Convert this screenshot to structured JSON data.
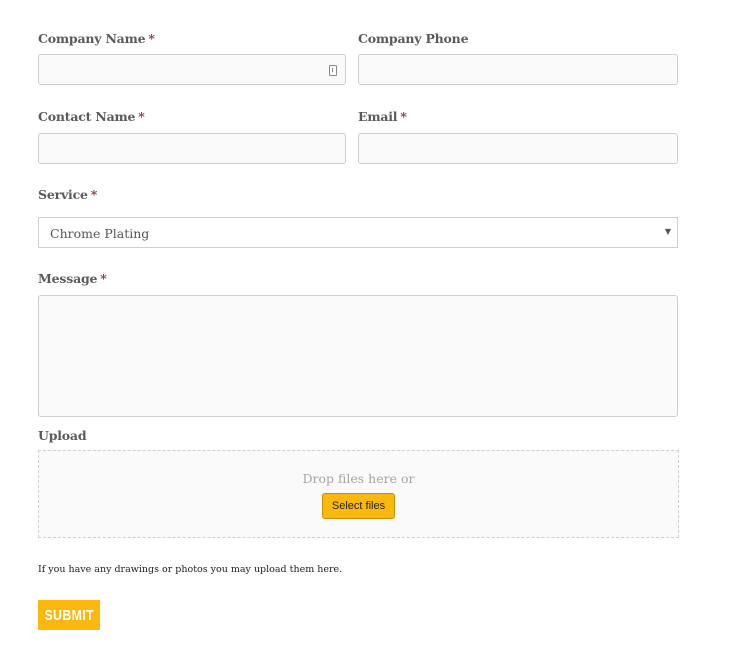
{
  "form": {
    "company_name": {
      "label": "Company Name",
      "required_mark": "*",
      "value": "",
      "placeholder": ""
    },
    "company_phone": {
      "label": "Company Phone",
      "value": "",
      "placeholder": ""
    },
    "contact_name": {
      "label": "Contact Name",
      "required_mark": "*",
      "value": "",
      "placeholder": ""
    },
    "email": {
      "label": "Email",
      "required_mark": "*",
      "value": "",
      "placeholder": ""
    },
    "service": {
      "label": "Service",
      "required_mark": "*",
      "selected": "Chrome Plating"
    },
    "message": {
      "label": "Message",
      "required_mark": "*",
      "value": ""
    },
    "upload": {
      "label": "Upload",
      "drop_text": "Drop files here or",
      "select_button": "Select files",
      "help_text": "If you have any drawings or photos you may upload them here."
    },
    "submit_label": "SUBMIT"
  },
  "colors": {
    "accent": "#fbb80f",
    "required": "#8b3a3a"
  }
}
